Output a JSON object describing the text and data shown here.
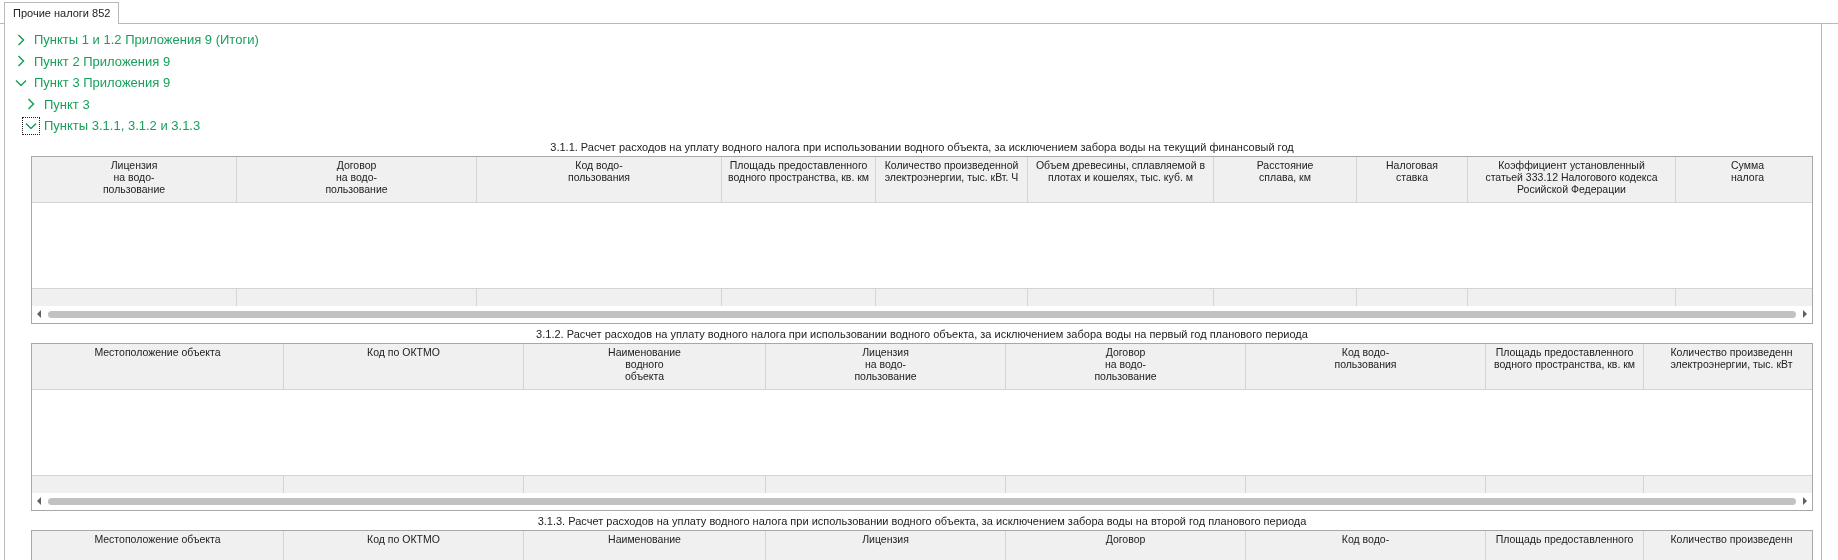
{
  "tabs": [
    {
      "label": "Прочие налоги 852",
      "selected": true
    }
  ],
  "tree": [
    {
      "label": "Пункты 1 и 1.2 Приложения 9 (Итоги)",
      "expanded": false,
      "focused": false
    },
    {
      "label": "Пункт 2 Приложения 9",
      "expanded": false,
      "focused": false
    },
    {
      "label": "Пункт 3 Приложения 9",
      "expanded": true,
      "focused": false,
      "children": [
        {
          "label": "Пункт 3",
          "expanded": false,
          "focused": false
        },
        {
          "label": "Пункты 3.1.1, 3.1.2 и 3.1.3",
          "expanded": true,
          "focused": true
        }
      ]
    }
  ],
  "tables": [
    {
      "title": "3.1.1. Расчет расходов на уплату водного налога при использовании водного объекта, за исключением забора воды на текущий финансовый год",
      "columns": [
        "Лицензия\nна водо-\nпользование",
        "Договор\nна водо-\nпользование",
        "Код водо-\nпользования",
        "Площадь предоставленного\nводного пространства, кв. км",
        "Количество произведенной\nэлектроэнергии, тыс. кВт. Ч",
        "Объем древесины, сплавляемой в\nплотах и кошелях, тыс. куб. м",
        "Расстояние\nсплава, км",
        "Налоговая\nставка",
        "Коэффициент установленный\nстатьей 333.12 Налогового кодекса\nРосийской Федерации",
        "Сумма\nналога"
      ]
    },
    {
      "title": "3.1.2. Расчет расходов на уплату водного налога при использовании водного объекта, за исключением забора воды на  первый год планового периода",
      "columns": [
        "Местоположение объекта",
        "Код по ОКТМО",
        "Наименование\nводного\nобъекта",
        "Лицензия\nна водо-\nпользование",
        "Договор\nна водо-\nпользование",
        "Код водо-\nпользования",
        "Площадь предоставленного\nводного пространства, кв. км",
        "Количество произведенн\nэлектроэнергии, тыс. кВт"
      ]
    },
    {
      "title": "3.1.3. Расчет расходов на уплату водного налога при использовании водного объекта, за исключением забора воды на второй год планового периода",
      "columns": [
        "Местоположение объекта",
        "Код по ОКТМО",
        "Наименование",
        "Лицензия",
        "Договор",
        "Код водо-",
        "Площадь предоставленного",
        "Количество произведенн"
      ]
    }
  ]
}
